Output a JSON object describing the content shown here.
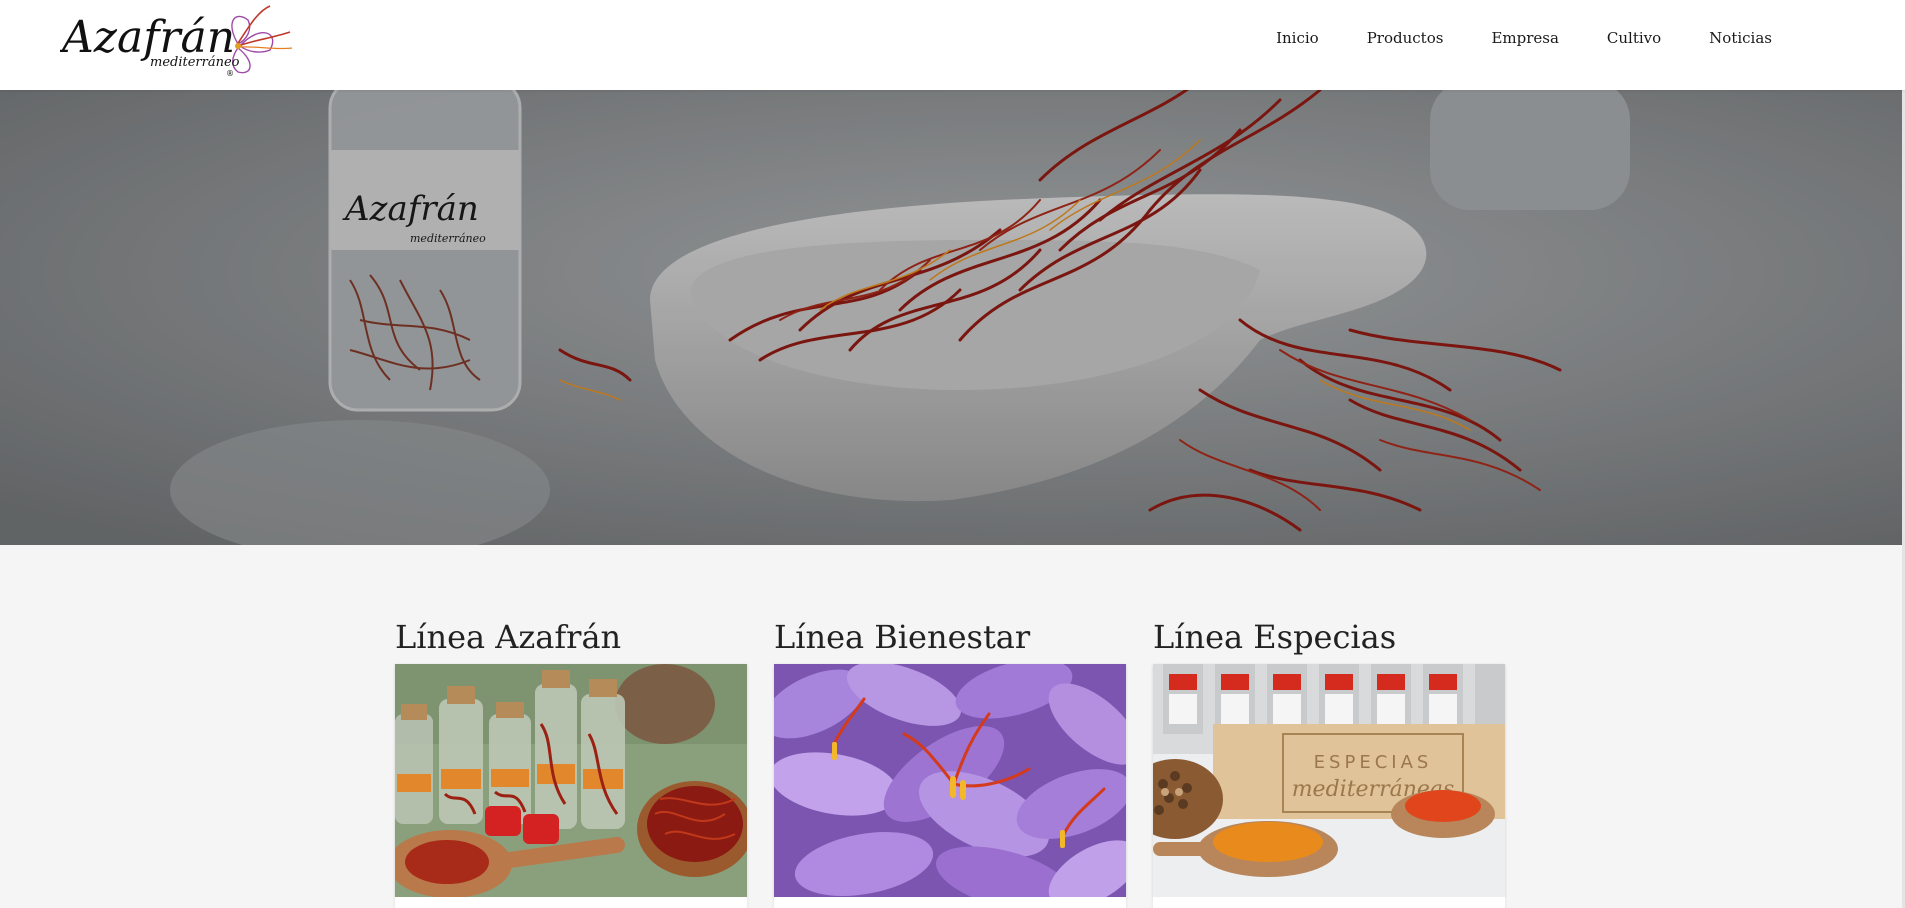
{
  "brand": {
    "logo_text": "Azafrán",
    "logo_subtext": "mediterráneo",
    "logo_mark": "®",
    "icon": "saffron-flower-logo"
  },
  "nav": {
    "items": [
      "Inicio",
      "Productos",
      "Empresa",
      "Cultivo",
      "Noticias"
    ]
  },
  "hero": {
    "jar_label": "Azafrán",
    "jar_sublabel": "mediterráneo"
  },
  "lines": [
    {
      "title": "Línea Azafrán",
      "image": "saffron-jars-photo"
    },
    {
      "title": "Línea Bienestar",
      "image": "crocus-flowers-photo"
    },
    {
      "title": "Línea Especias",
      "image": "spice-jars-photo",
      "box_text": "ESPECIAS",
      "box_subtext": "mediterráneas"
    }
  ],
  "colors": {
    "saffron_red": "#8b1a12",
    "crocus_purple": "#9b6fcf",
    "background": "#f5f5f5"
  }
}
